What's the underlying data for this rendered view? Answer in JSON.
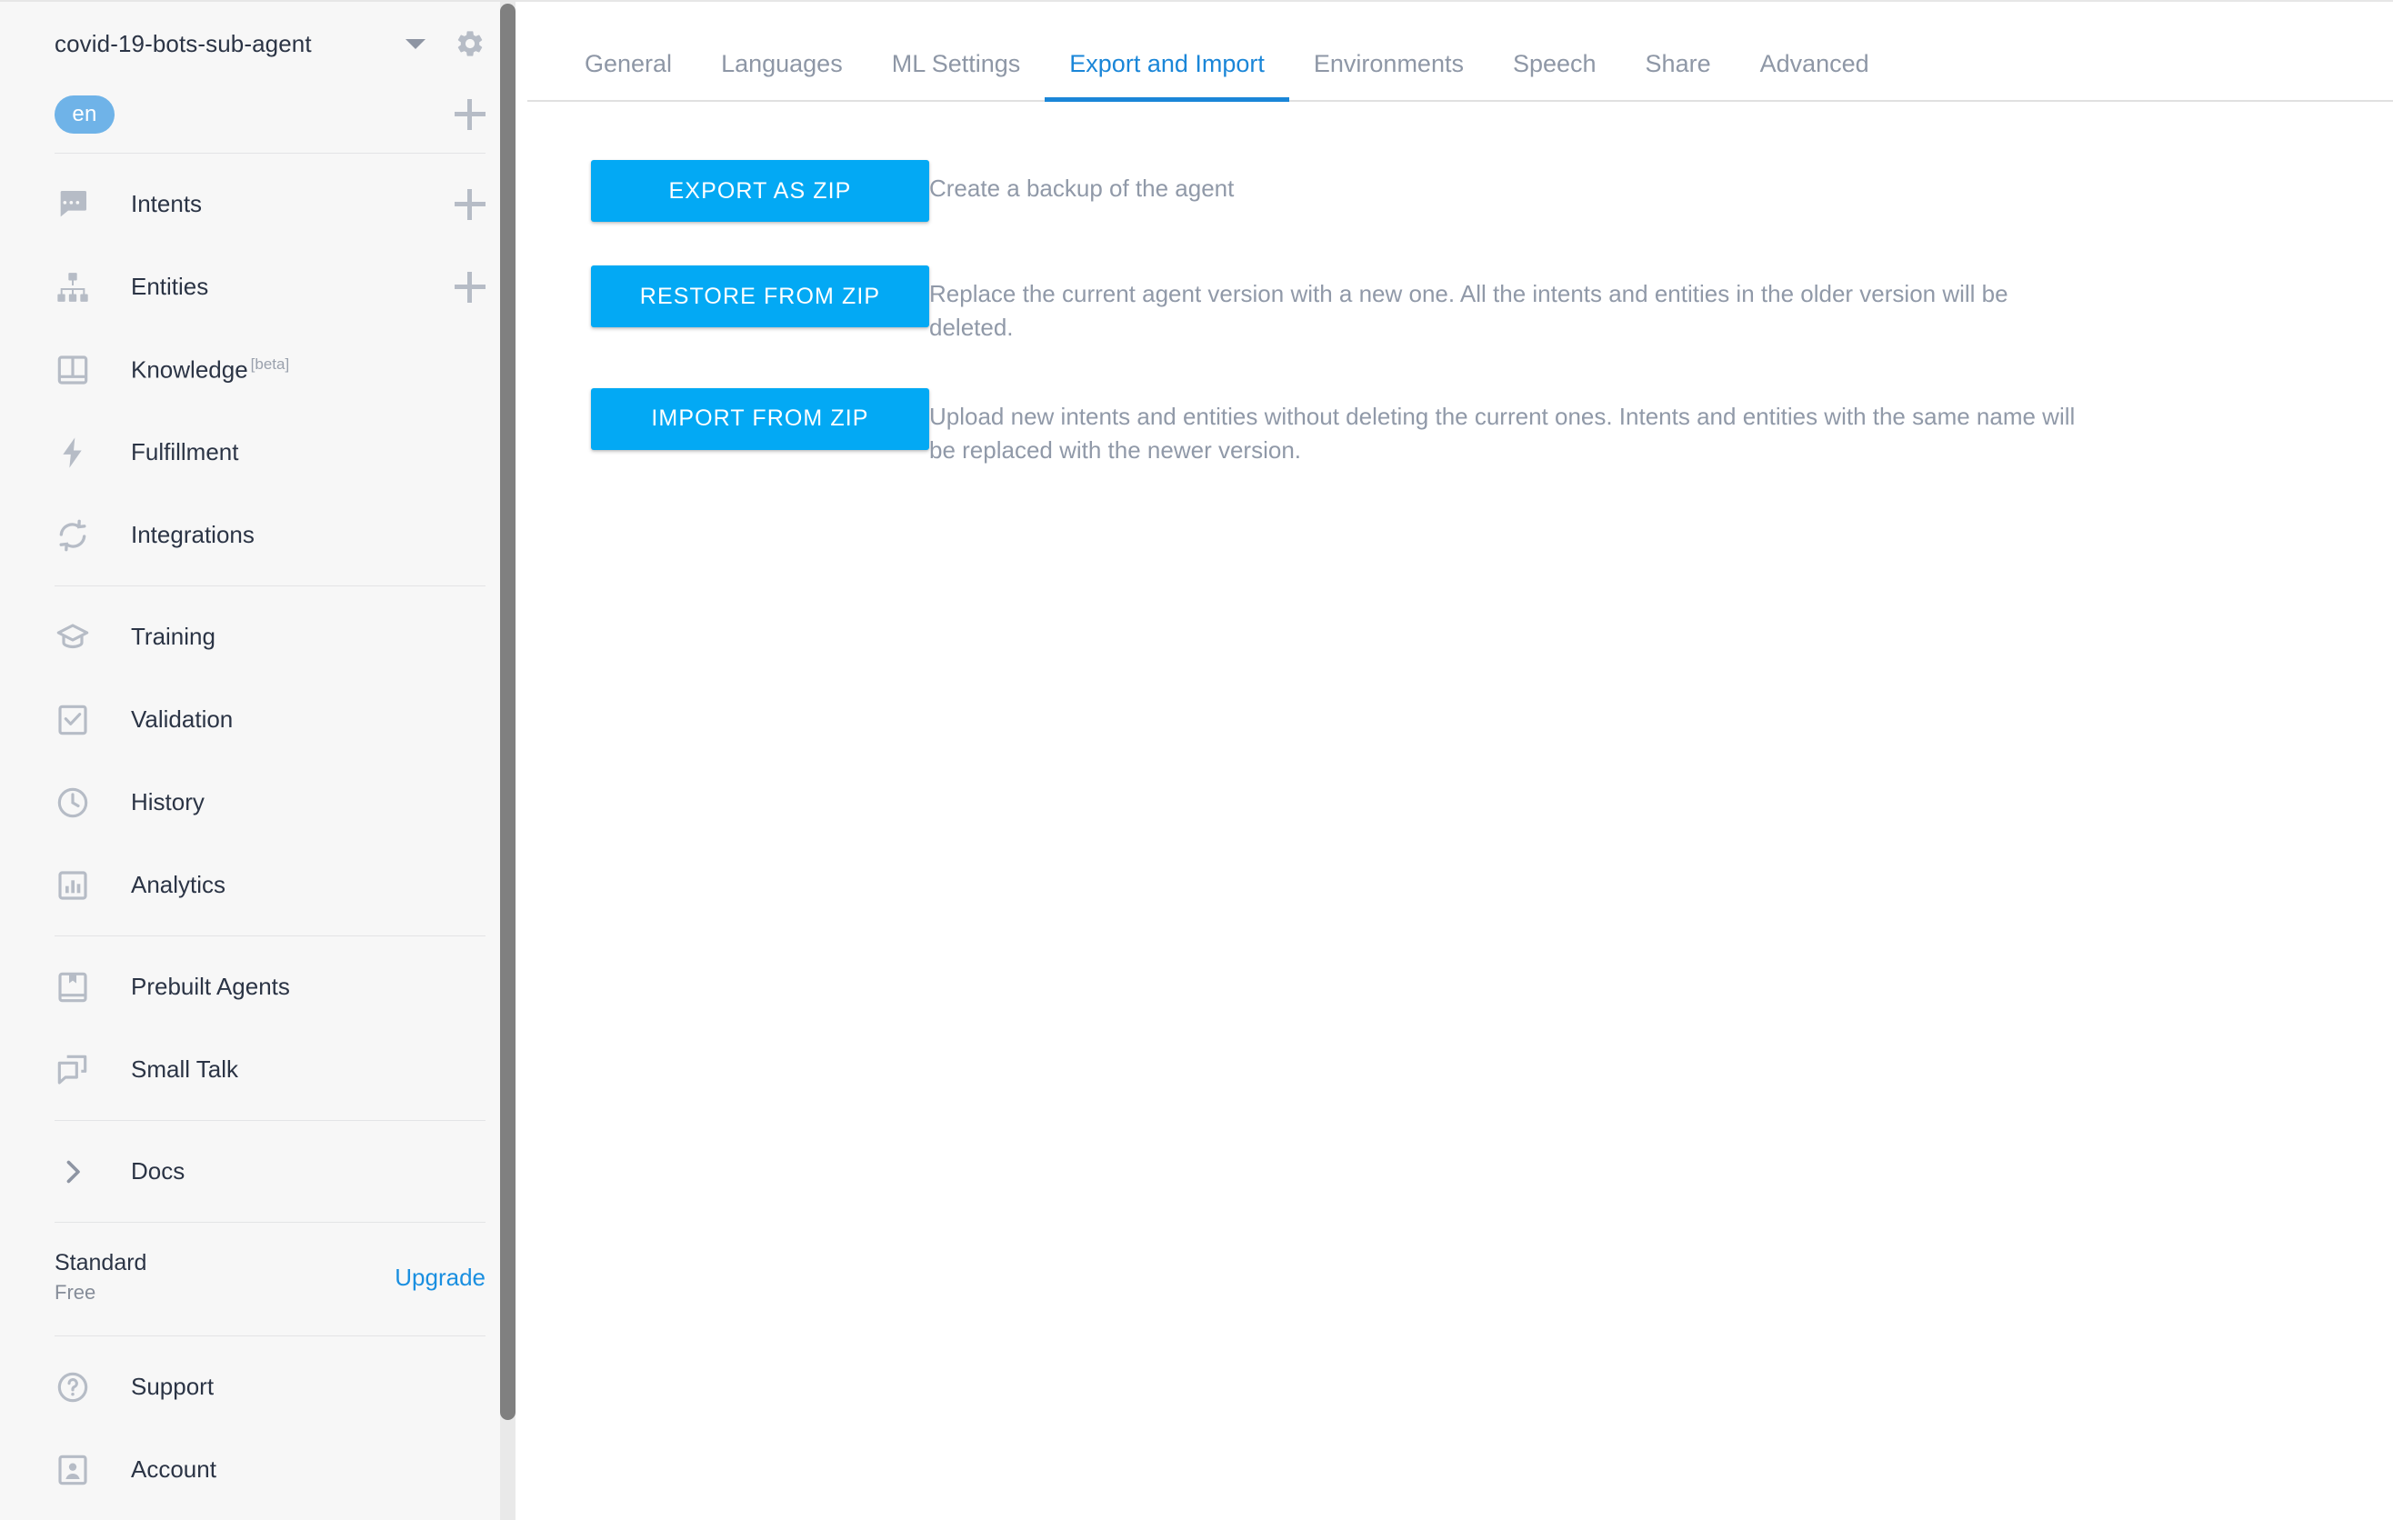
{
  "sidebar": {
    "agent": {
      "name": "covid-19-bots-sub-agent",
      "dropdown_icon": "chevron-down-icon",
      "settings_icon": "gear-icon"
    },
    "language": {
      "chip": "en",
      "add_icon": "plus-icon"
    },
    "nav_groups": [
      {
        "items": [
          {
            "label": "Intents",
            "icon": "intents-icon",
            "action_icon": "plus-icon"
          },
          {
            "label": "Entities",
            "icon": "entities-icon",
            "action_icon": "plus-icon"
          },
          {
            "label": "Knowledge",
            "badge": "[beta]",
            "icon": "knowledge-icon"
          },
          {
            "label": "Fulfillment",
            "icon": "fulfillment-icon"
          },
          {
            "label": "Integrations",
            "icon": "integrations-icon"
          }
        ]
      },
      {
        "items": [
          {
            "label": "Training",
            "icon": "training-icon"
          },
          {
            "label": "Validation",
            "icon": "validation-icon"
          },
          {
            "label": "History",
            "icon": "history-icon"
          },
          {
            "label": "Analytics",
            "icon": "analytics-icon"
          }
        ]
      },
      {
        "items": [
          {
            "label": "Prebuilt Agents",
            "icon": "prebuilt-agents-icon"
          },
          {
            "label": "Small Talk",
            "icon": "small-talk-icon"
          }
        ]
      },
      {
        "items": [
          {
            "label": "Docs",
            "icon": "chevron-right-icon"
          }
        ]
      }
    ],
    "plan": {
      "title": "Standard",
      "subtitle": "Free",
      "upgrade_label": "Upgrade"
    },
    "footer_items": [
      {
        "label": "Support",
        "icon": "help-circle-icon"
      },
      {
        "label": "Account",
        "icon": "account-icon"
      }
    ]
  },
  "tabs": [
    {
      "label": "General",
      "active": false
    },
    {
      "label": "Languages",
      "active": false
    },
    {
      "label": "ML Settings",
      "active": false
    },
    {
      "label": "Export and Import",
      "active": true
    },
    {
      "label": "Environments",
      "active": false
    },
    {
      "label": "Speech",
      "active": false
    },
    {
      "label": "Share",
      "active": false
    },
    {
      "label": "Advanced",
      "active": false
    }
  ],
  "main": {
    "actions": [
      {
        "button_label": "EXPORT AS ZIP",
        "description": "Create a backup of the agent"
      },
      {
        "button_label": "RESTORE FROM ZIP",
        "description": "Replace the current agent version with a new one. All the intents and entities in the older version will be deleted."
      },
      {
        "button_label": "IMPORT FROM ZIP",
        "description": "Upload new intents and entities without deleting the current ones. Intents and entities with the same name will be replaced with the newer version."
      }
    ]
  },
  "colors": {
    "accent_blue": "#03a9f4",
    "tab_active_blue": "#1a86d8",
    "link_blue": "#1a8fe0",
    "chip_blue": "#6fb3e8",
    "sidebar_bg": "#f7f7f7",
    "icon_gray": "#b6bcc6",
    "text_dark": "#2b3445",
    "text_muted": "#9099a8"
  }
}
